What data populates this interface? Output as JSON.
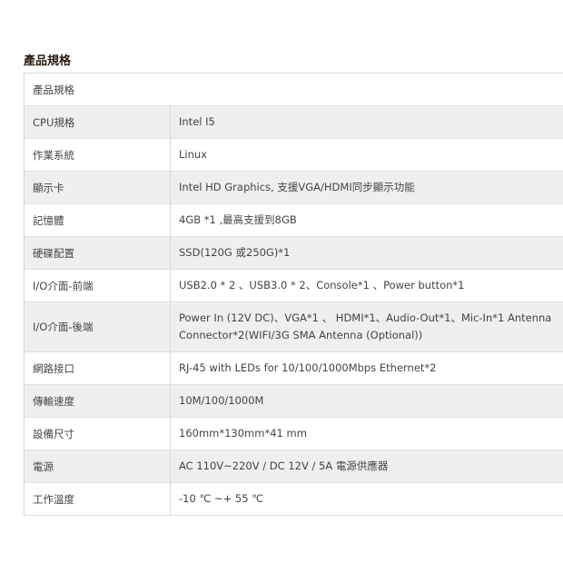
{
  "section_title": "產品規格",
  "table_header": "產品規格",
  "rows": [
    {
      "label": "CPU規格",
      "value": "Intel I5"
    },
    {
      "label": "作業系統",
      "value": "Linux"
    },
    {
      "label": "顯示卡",
      "value": "Intel HD Graphics, 支援VGA/HDMI同步顯示功能"
    },
    {
      "label": "記憶體",
      "value": "4GB *1 ,最高支援到8GB"
    },
    {
      "label": "硬碟配置",
      "value": "SSD(120G 或250G)*1"
    },
    {
      "label": "I/O介面-前端",
      "value": "USB2.0 * 2 、USB3.0 * 2、Console*1 、Power button*1"
    },
    {
      "label": "I/O介面-後端",
      "value": "Power In (12V DC)、VGA*1 、 HDMI*1、Audio-Out*1、Mic-In*1 Antenna Connector*2(WIFI/3G SMA Antenna (Optional))"
    },
    {
      "label": "網路接口",
      "value": "RJ-45 with LEDs for 10/100/1000Mbps Ethernet*2"
    },
    {
      "label": "傳輸速度",
      "value": "10M/100/1000M"
    },
    {
      "label": "設備尺寸",
      "value": "160mm*130mm*41 mm"
    },
    {
      "label": "電源",
      "value": "AC 110V~220V / DC 12V / 5A 電源供應器"
    },
    {
      "label": "工作溫度",
      "value": "-10 ℃ ~+ 55 ℃"
    }
  ]
}
